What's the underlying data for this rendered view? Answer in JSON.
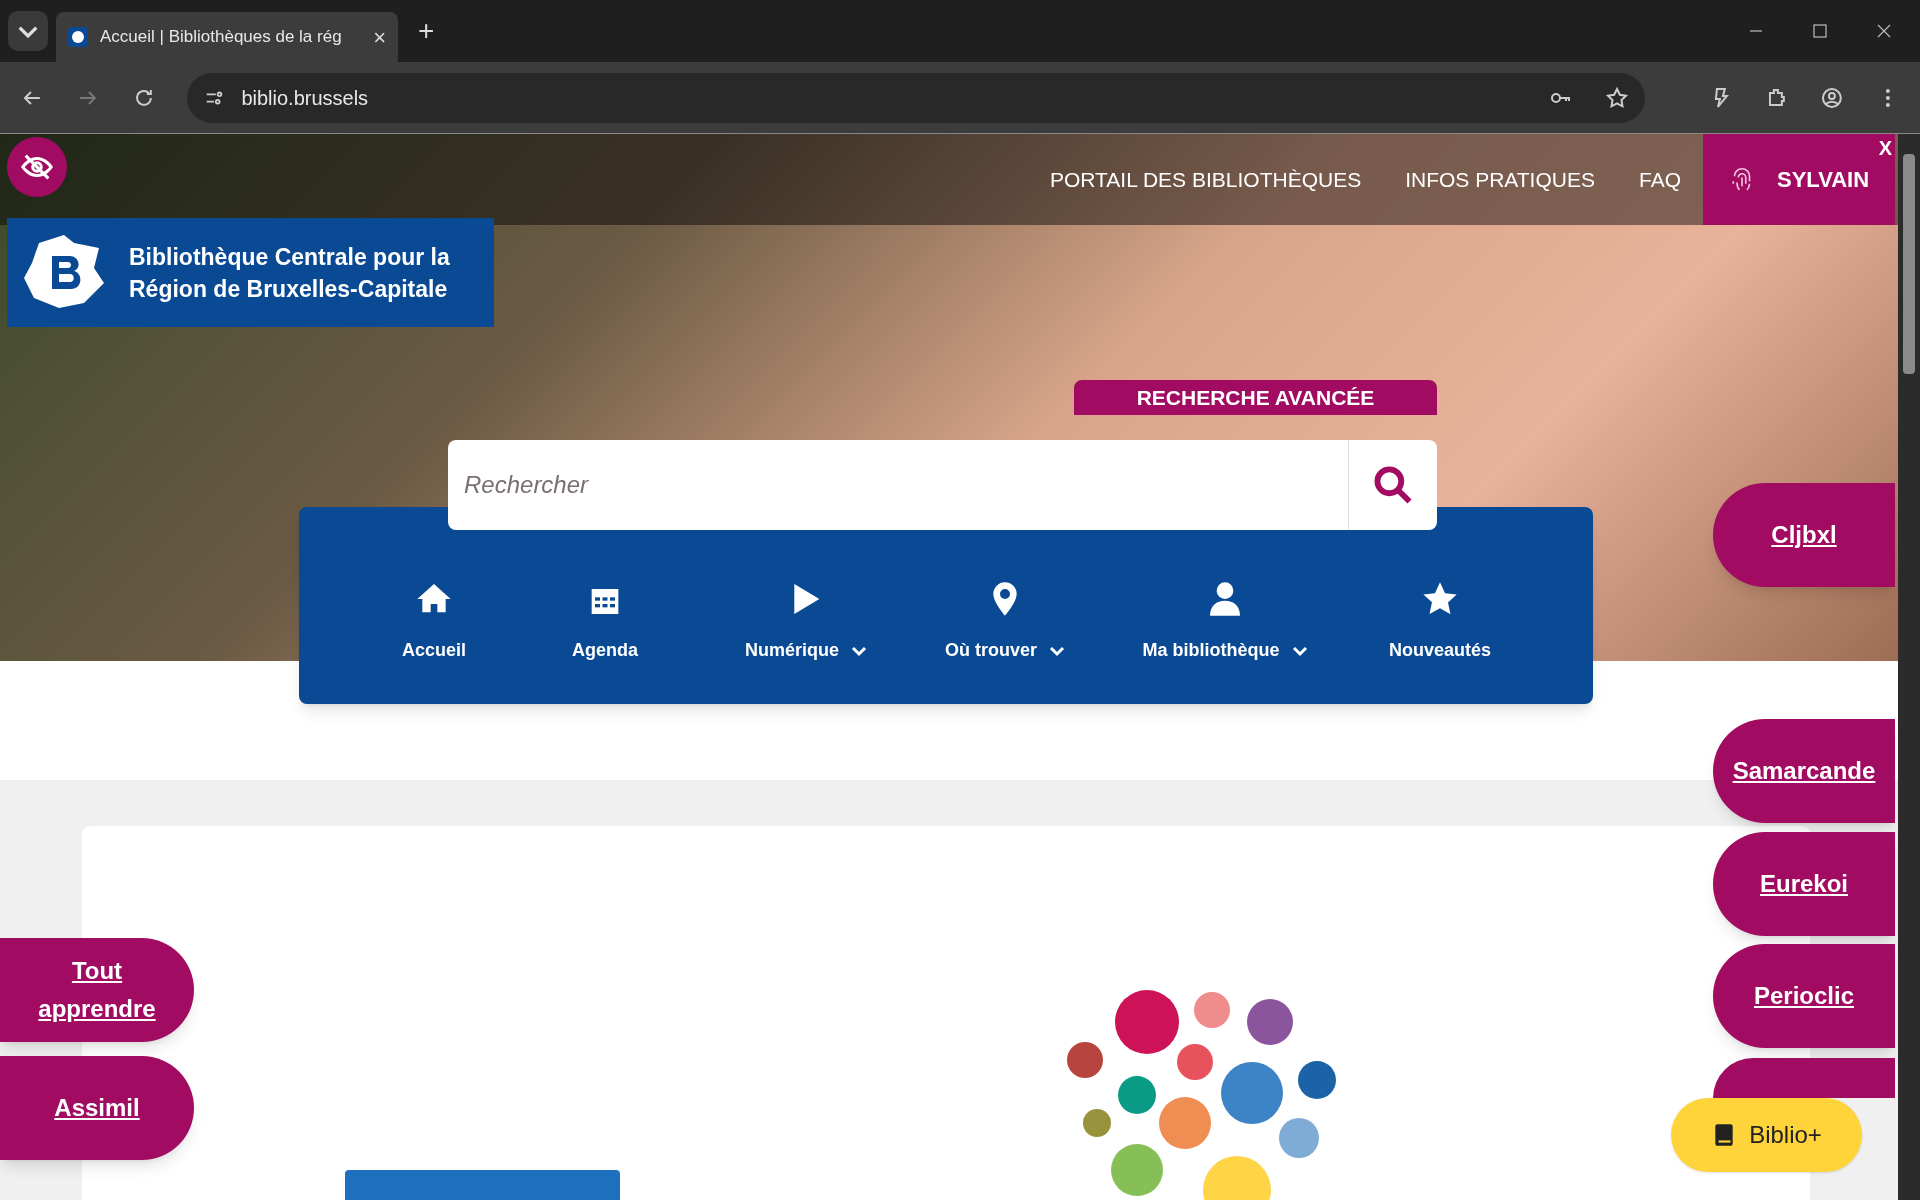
{
  "browser": {
    "tab": {
      "title": "Accueil | Bibliothèques de la rég",
      "close": "×"
    },
    "new_tab": "+",
    "address": "biblio.brussels"
  },
  "header": {
    "links": [
      "PORTAIL DES BIBLIOTHÈQUES",
      "INFOS PRATIQUES",
      "FAQ"
    ],
    "user": "SYLVAIN",
    "close": "X"
  },
  "logo": {
    "line1": "Bibliothèque Centrale pour la",
    "line2": "Région de Bruxelles-Capitale"
  },
  "search": {
    "advanced": "RECHERCHE AVANCÉE",
    "placeholder": "Rechercher"
  },
  "nav": [
    {
      "label": "Accueil",
      "dropdown": false
    },
    {
      "label": "Agenda",
      "dropdown": false
    },
    {
      "label": "Numérique",
      "dropdown": true
    },
    {
      "label": "Où trouver",
      "dropdown": true
    },
    {
      "label": "Ma bibliothèque",
      "dropdown": true
    },
    {
      "label": "Nouveautés",
      "dropdown": false
    }
  ],
  "right_links": [
    "Cljbxl",
    "Samarcande",
    "Eurekoi",
    "Perioclic"
  ],
  "left_links": [
    "Tout apprendre",
    "Assimil"
  ],
  "biblio_plus": "Biblio+"
}
